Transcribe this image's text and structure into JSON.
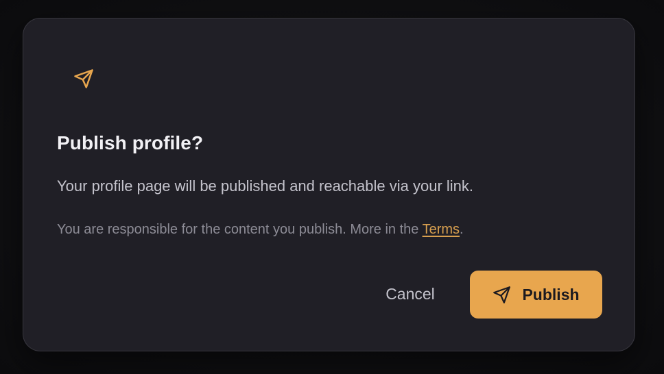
{
  "dialog": {
    "icon": "send-icon",
    "title": "Publish profile?",
    "body": "Your profile page will be published and reachable via your link.",
    "note_prefix": "You are responsible for the content you publish. More in the ",
    "terms_link": "Terms",
    "note_suffix": ".",
    "actions": {
      "cancel_label": "Cancel",
      "publish_label": "Publish",
      "publish_icon": "send-icon"
    }
  },
  "colors": {
    "accent": "#e8a64e",
    "dialog_background": "#201f26",
    "page_background": "#0f0f11",
    "title_text": "#f2f1f5",
    "body_text": "#c4c3cc",
    "muted_text": "#8d8c96"
  }
}
